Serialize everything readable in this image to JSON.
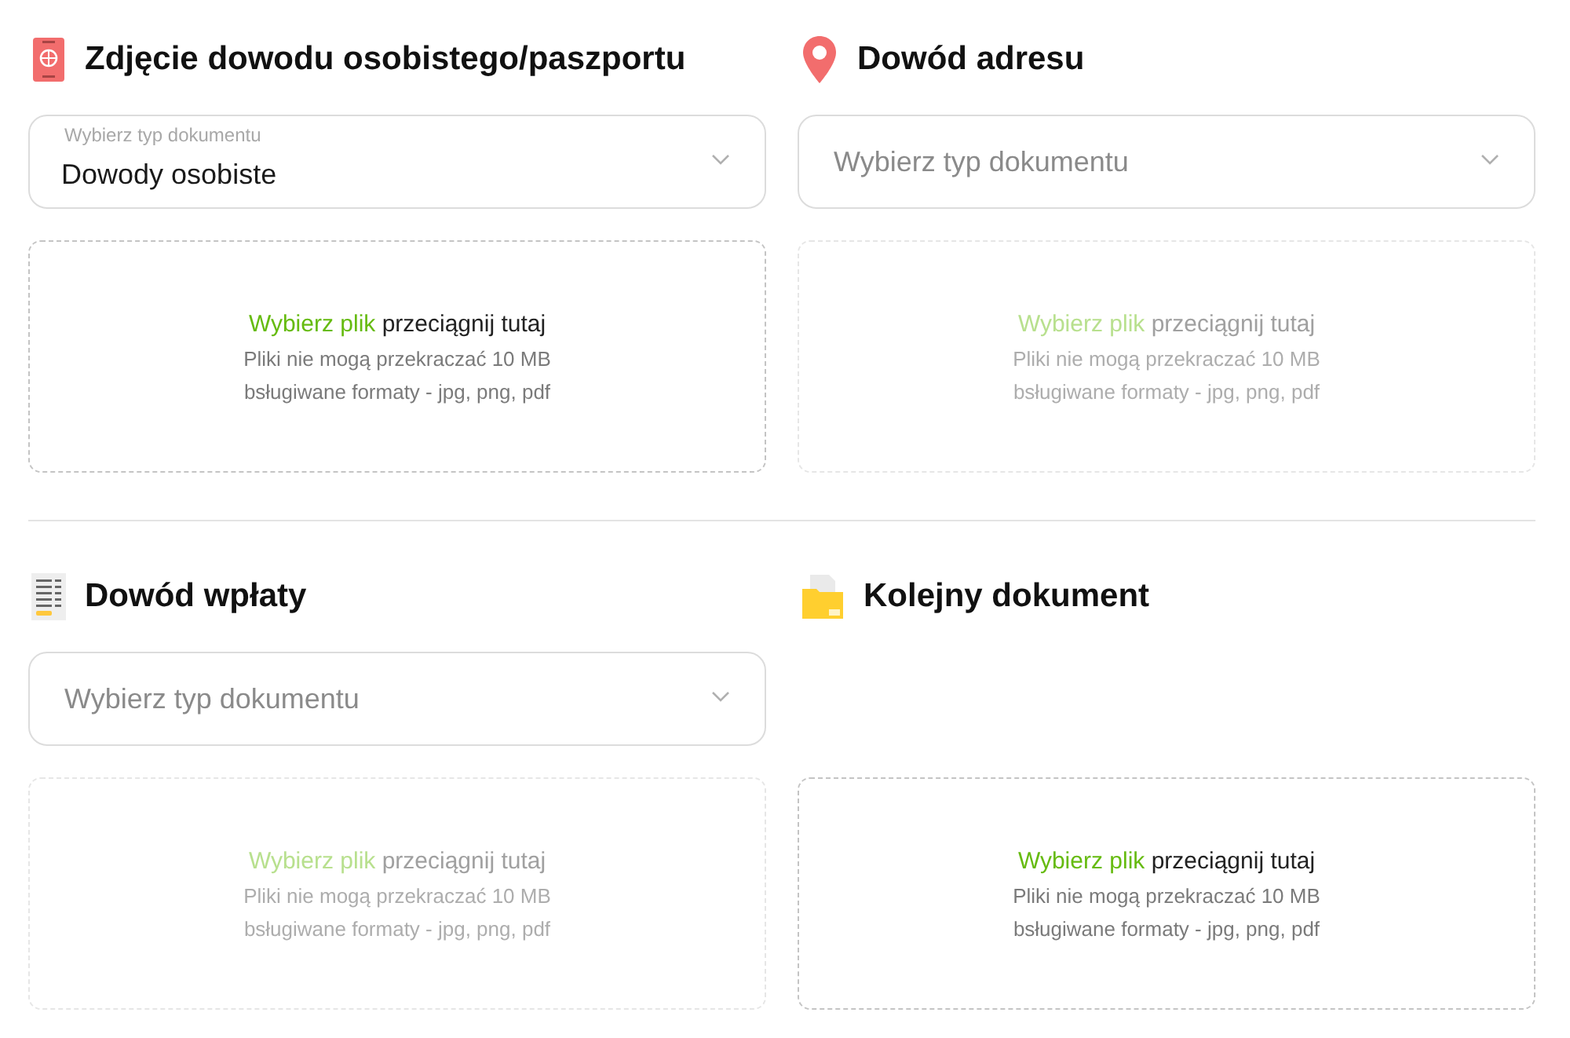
{
  "sections": [
    {
      "kind": "passport",
      "title": "Zdjęcie dowodu osobistego/paszportu",
      "select": {
        "placeholder": "Wybierz typ dokumentu",
        "value": "Dowody osobiste"
      },
      "dropzone": {
        "disabled": false,
        "link": "Wybierz plik",
        "text": "przeciągnij tutaj",
        "limit": "Pliki nie mogą przekraczać 10 MB",
        "formats": "bsługiwane formaty - jpg, png, pdf"
      }
    },
    {
      "kind": "pin",
      "title": "Dowód adresu",
      "select": {
        "placeholder": "Wybierz typ dokumentu"
      },
      "dropzone": {
        "disabled": true,
        "link": "Wybierz plik",
        "text": "przeciągnij tutaj",
        "limit": "Pliki nie mogą przekraczać 10 MB",
        "formats": "bsługiwane formaty - jpg, png, pdf"
      }
    },
    {
      "kind": "receipt",
      "title": "Dowód wpłaty",
      "select": {
        "placeholder": "Wybierz typ dokumentu"
      },
      "dropzone": {
        "disabled": true,
        "link": "Wybierz plik",
        "text": "przeciągnij tutaj",
        "limit": "Pliki nie mogą przekraczać 10 MB",
        "formats": "bsługiwane formaty - jpg, png, pdf"
      }
    },
    {
      "kind": "folder",
      "title": "Kolejny dokument",
      "dropzone": {
        "disabled": false,
        "link": "Wybierz plik",
        "text": "przeciągnij tutaj",
        "limit": "Pliki nie mogą przekraczać 10 MB",
        "formats": "bsługiwane formaty - jpg, png, pdf"
      }
    }
  ]
}
